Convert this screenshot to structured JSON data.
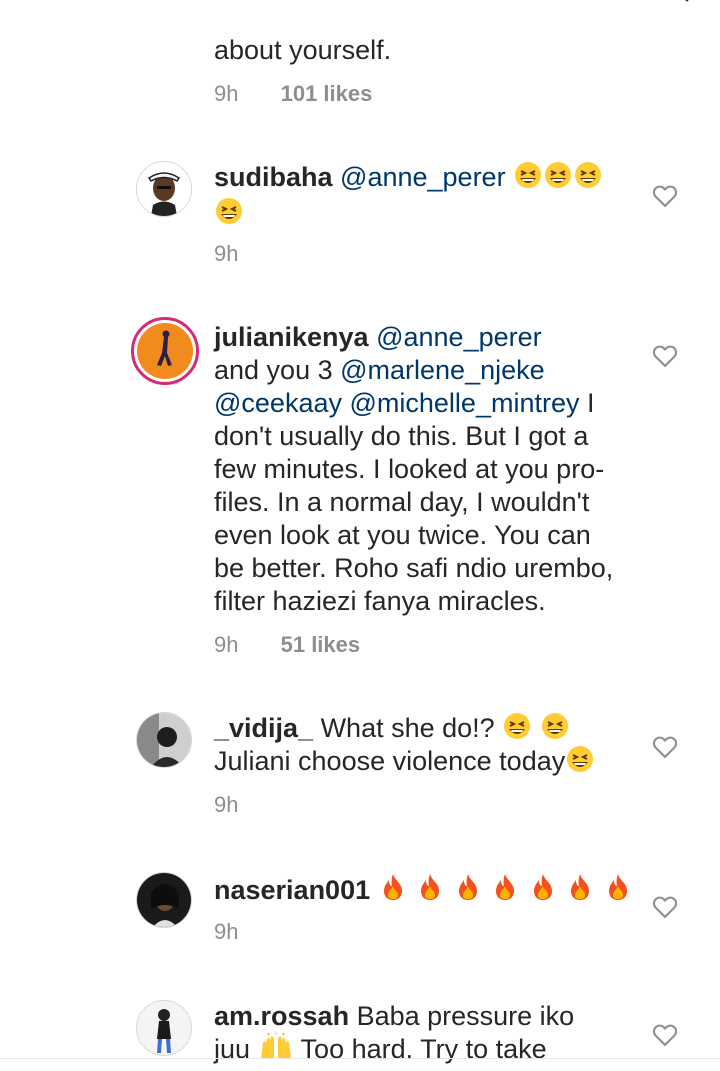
{
  "comment0": {
    "text": "about yourself.",
    "time": "9h",
    "likes": "101 likes"
  },
  "comment1": {
    "user": "sudibaha",
    "mention": "@anne_perer",
    "time": "9h"
  },
  "comment2": {
    "user": "julianikenya",
    "mention": "@anne_perer",
    "line2_text": "and you 3 ",
    "mention2": "@marlene_njeke",
    "mention3": "@ceekaay",
    "mention4": "@michelle_mintrey",
    "line3_tail": " I",
    "line4": "don't usually do this. But I got a",
    "line5": "few minutes. I looked at you pro-",
    "line6": "files. In a normal day, I wouldn't",
    "line7": "even look at you twice. You can",
    "line8": "be better. Roho safi ndio urembo,",
    "line9": "filter haziezi fanya miracles.",
    "time": "9h",
    "likes": "51 likes"
  },
  "comment3": {
    "user": "_vidija_",
    "text1": " What she do!?",
    "text2": "Juliani choose violence today",
    "time": "9h"
  },
  "comment4": {
    "user": "naserian001",
    "time": "9h"
  },
  "comment5": {
    "user": "am.rossah",
    "text1": " Baba pressure iko",
    "text2a": "juu",
    "text2b": " Too hard. Try to take"
  },
  "icons": {
    "laugh": "grinning-squinting-face-icon",
    "fire": "fire-icon",
    "hands": "raising-hands-icon",
    "heart": "heart-outline-icon"
  }
}
